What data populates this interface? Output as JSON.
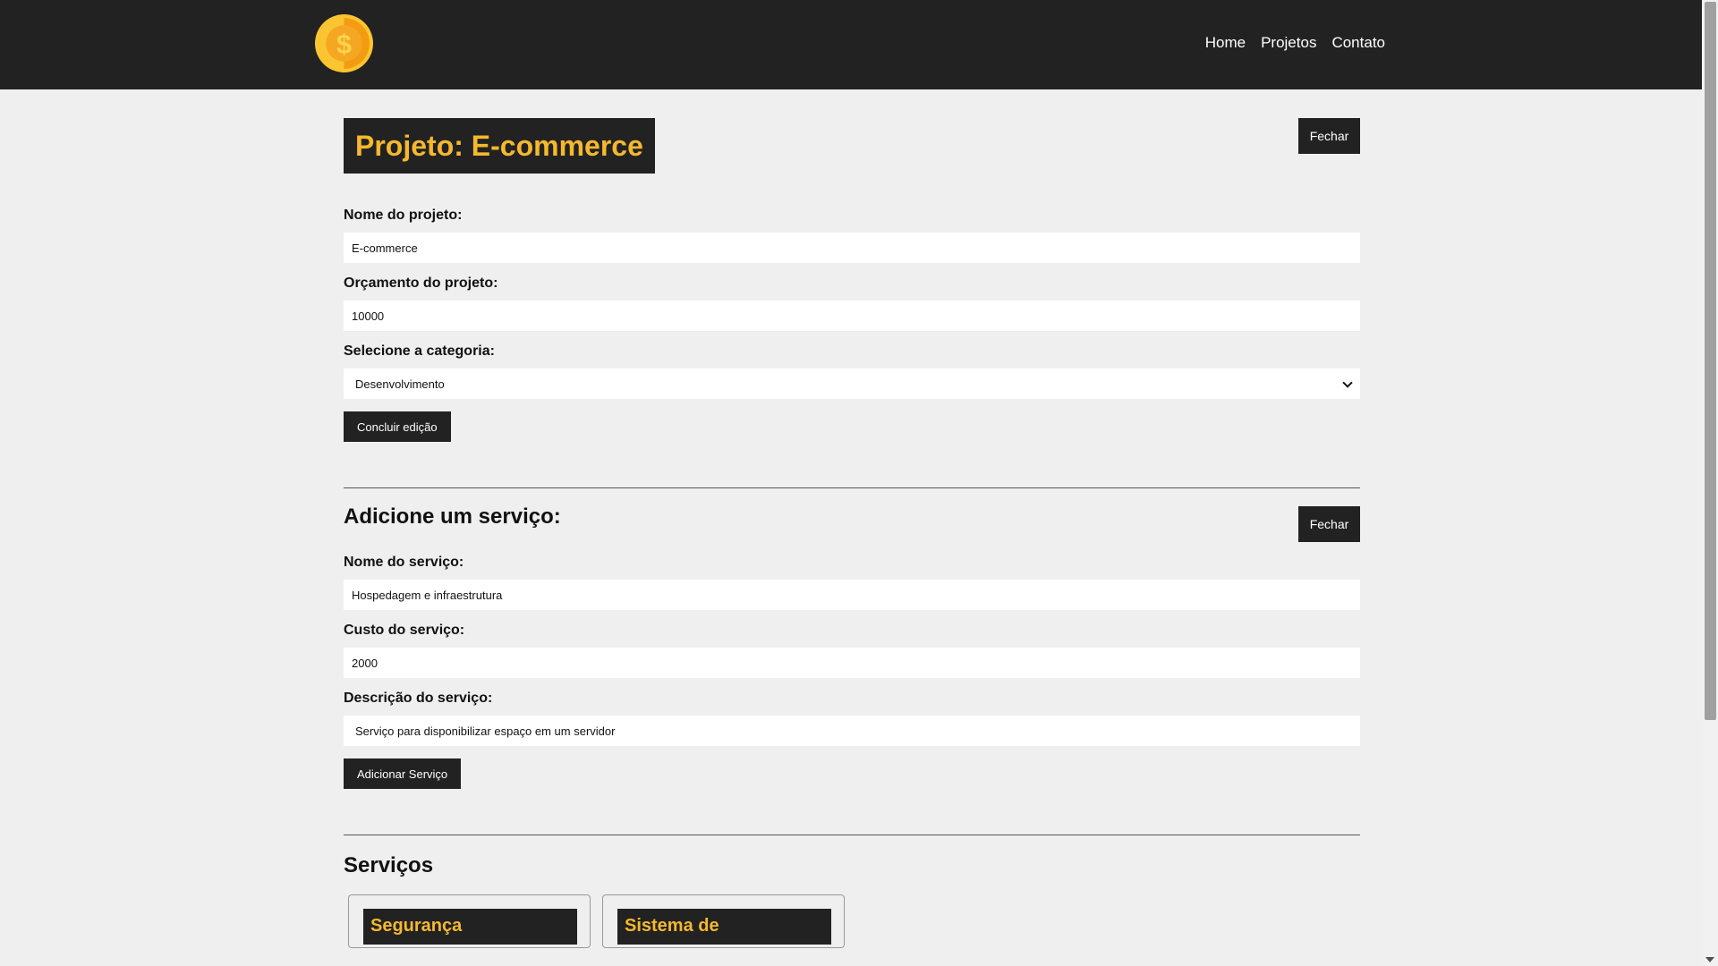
{
  "nav": {
    "logo_alt": "$",
    "links": [
      "Home",
      "Projetos",
      "Contato"
    ]
  },
  "project": {
    "title": "Projeto: E-commerce",
    "close_label": "Fechar",
    "name_label": "Nome do projeto:",
    "name_value": "E-commerce",
    "budget_label": "Orçamento do projeto:",
    "budget_value": "10000",
    "category_label": "Selecione a categoria:",
    "category_value": "Desenvolvimento",
    "submit_label": "Concluir edição"
  },
  "service_form": {
    "title": "Adicione um serviço:",
    "close_label": "Fechar",
    "name_label": "Nome do serviço:",
    "name_value": "Hospedagem e infraestrutura",
    "cost_label": "Custo do serviço:",
    "cost_value": "2000",
    "description_label": "Descrição do serviço:",
    "description_value": "Serviço para disponibilizar espaço em um servidor",
    "submit_label": "Adicionar Serviço"
  },
  "services": {
    "title": "Serviços",
    "cards": [
      "Segurança",
      "Sistema de"
    ]
  },
  "colors": {
    "accent": "#f5b82e",
    "dark": "#222222",
    "background": "#efefef"
  }
}
